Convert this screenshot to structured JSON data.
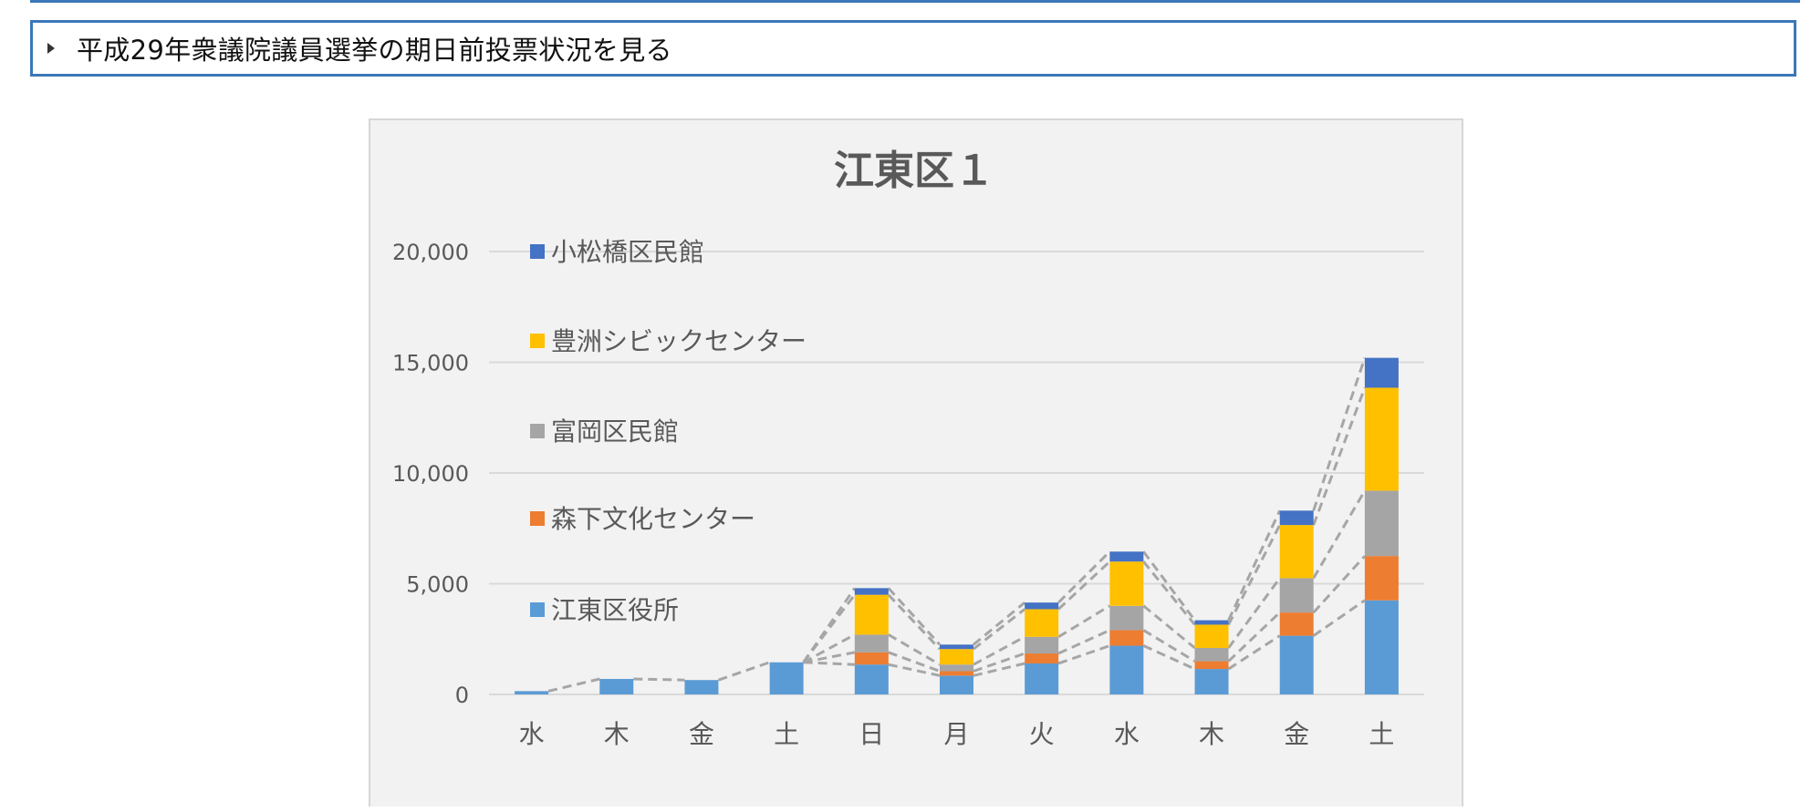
{
  "accordion": {
    "label": "平成29年衆議院議員選挙の期日前投票状況を見る"
  },
  "chart_data": {
    "type": "bar",
    "stacked": true,
    "title": "江東区１",
    "xlabel": "",
    "ylabel": "",
    "ylim": [
      0,
      20000
    ],
    "yticks": [
      0,
      5000,
      10000,
      15000,
      20000
    ],
    "ytick_labels": [
      "0",
      "5,000",
      "10,000",
      "15,000",
      "20,000"
    ],
    "grid": true,
    "legend_position": "top-left",
    "connector_lines": "dashed",
    "categories": [
      "水",
      "木",
      "金",
      "土",
      "日",
      "月",
      "火",
      "水",
      "木",
      "金",
      "土"
    ],
    "series": [
      {
        "name": "江東区役所",
        "color": "#5b9bd5",
        "values": [
          150,
          700,
          650,
          1450,
          1350,
          850,
          1400,
          2200,
          1150,
          2650,
          4250
        ]
      },
      {
        "name": "森下文化センター",
        "color": "#ed7d31",
        "values": [
          0,
          0,
          0,
          0,
          550,
          200,
          450,
          700,
          350,
          1050,
          2000
        ]
      },
      {
        "name": "富岡区民館",
        "color": "#a5a5a5",
        "values": [
          0,
          0,
          0,
          0,
          800,
          300,
          750,
          1100,
          600,
          1550,
          2950
        ]
      },
      {
        "name": "豊洲シビックセンター",
        "color": "#ffc000",
        "values": [
          0,
          0,
          0,
          0,
          1800,
          700,
          1250,
          2000,
          1050,
          2400,
          4650
        ]
      },
      {
        "name": "小松橋区民館",
        "color": "#4472c4",
        "values": [
          0,
          0,
          0,
          0,
          300,
          200,
          300,
          450,
          200,
          650,
          1350
        ]
      }
    ]
  }
}
